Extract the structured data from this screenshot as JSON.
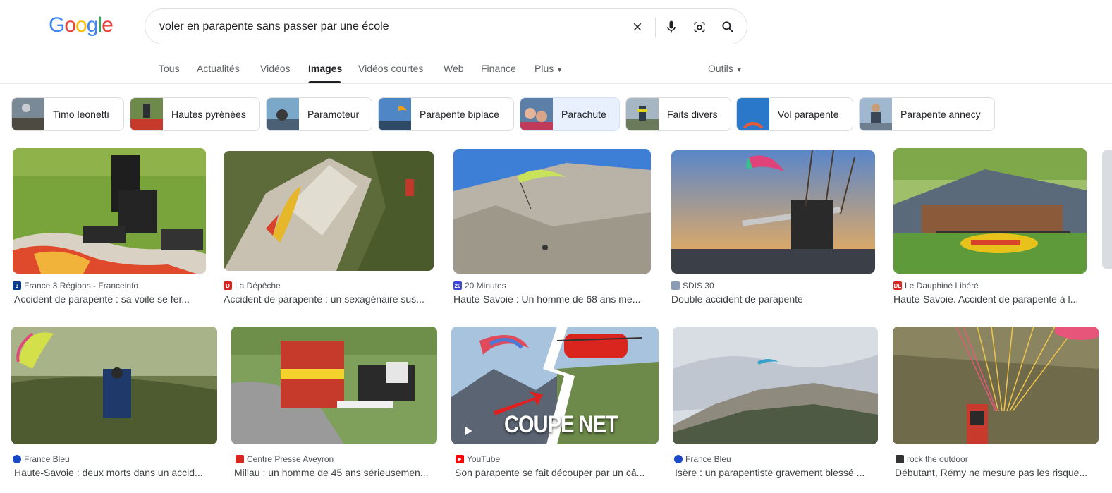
{
  "logo": {
    "letters": [
      "G",
      "o",
      "o",
      "g",
      "l",
      "e"
    ],
    "colors": [
      "#4285f4",
      "#ea4335",
      "#fbbc05",
      "#4285f4",
      "#34a853",
      "#ea4335"
    ]
  },
  "search": {
    "value": "voler en parapente sans passer par une école",
    "clear_icon": "close-icon",
    "voice_icon": "mic-icon",
    "lens_icon": "lens-icon",
    "search_icon": "search-icon"
  },
  "tabs": [
    {
      "label": "Tous"
    },
    {
      "label": "Actualités"
    },
    {
      "label": "Vidéos"
    },
    {
      "label": "Images",
      "active": true
    },
    {
      "label": "Vidéos courtes"
    },
    {
      "label": "Web"
    },
    {
      "label": "Finance"
    },
    {
      "label": "Plus"
    }
  ],
  "tools_label": "Outils",
  "chips": [
    {
      "label": "Timo leonetti"
    },
    {
      "label": "Hautes pyrénées"
    },
    {
      "label": "Paramoteur"
    },
    {
      "label": "Parapente biplace"
    },
    {
      "label": "Parachute",
      "selected": true
    },
    {
      "label": "Faits divers"
    },
    {
      "label": "Vol parapente"
    },
    {
      "label": "Parapente annecy"
    }
  ],
  "results_row1": [
    {
      "source": "France 3 Régions - Franceinfo",
      "title": "Accident de parapente : sa voile se fer...",
      "favicon_color": "#0a3b8c",
      "favicon_glyph": "3"
    },
    {
      "source": "La Dépêche",
      "title": "Accident de parapente : un sexagénaire sus...",
      "favicon_color": "#d7261e",
      "favicon_glyph": "D"
    },
    {
      "source": "20 Minutes",
      "title": "Haute-Savoie : Un homme de 68 ans me...",
      "favicon_color": "#3b46d6",
      "favicon_glyph": "20"
    },
    {
      "source": "SDIS 30",
      "title": "Double accident de parapente",
      "favicon_color": "#8a9bb5",
      "favicon_glyph": ""
    },
    {
      "source": "Le Dauphiné Libéré",
      "title": "Haute-Savoie. Accident de parapente à l...",
      "favicon_color": "#d7261e",
      "favicon_glyph": "DL"
    }
  ],
  "results_row2": [
    {
      "source": "France Bleu",
      "title": "Haute-Savoie : deux morts dans un accid...",
      "favicon_color": "#1a49c7",
      "favicon_glyph": ""
    },
    {
      "source": "Centre Presse Aveyron",
      "title": "Millau : un homme de 45 ans sérieusemen...",
      "favicon_color": "#d7261e",
      "favicon_glyph": ""
    },
    {
      "source": "YouTube",
      "title": "Son parapente se fait découper par un câ...",
      "favicon_color": "#ff0000",
      "favicon_glyph": "▶",
      "overlay": "COUPE NET"
    },
    {
      "source": "France Bleu",
      "title": "Isère : un parapentiste gravement blessé ...",
      "favicon_color": "#1a49c7",
      "favicon_glyph": ""
    },
    {
      "source": "rock the outdoor",
      "title": "Débutant, Rémy ne mesure pas les risque...",
      "favicon_color": "#333333",
      "favicon_glyph": ""
    }
  ]
}
